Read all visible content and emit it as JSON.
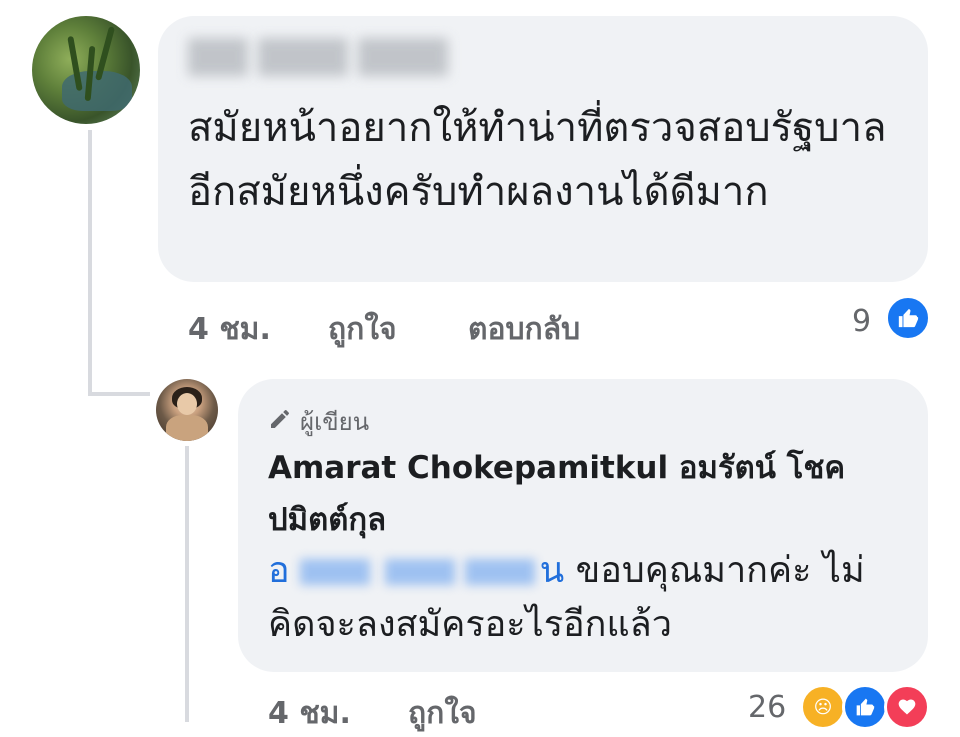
{
  "comment": {
    "author_blurred": true,
    "text": "สมัยหน้าอยากให้ทำน่าที่ตรวจสอบรัฐบาลอีกสมัยหนึ่งครับทำผลงานได้ดีมาก",
    "time": "4 ชม.",
    "like_label": "ถูกใจ",
    "reply_label": "ตอบกลับ",
    "reaction_count": "9",
    "reaction_icon": "like-icon",
    "reaction_color": "#1877f2"
  },
  "reply": {
    "badge_icon": "pencil-icon",
    "badge_label": "ผู้เขียน",
    "author": "Amarat Chokepamitkul อมรัตน์ โชคปมิตต์กุล",
    "mention_start": "อ",
    "mention_end": "น",
    "text": " ขอบคุณมากค่ะ ไม่คิดจะลงสมัครอะไรอีกแล้ว",
    "time": "4 ชม.",
    "like_label": "ถูกใจ",
    "reaction_count": "26",
    "reactions": [
      "sad-icon",
      "like-icon",
      "love-icon"
    ],
    "colors": {
      "sad": "#f7b125",
      "like": "#1877f2",
      "love": "#f33e58",
      "mention": "#216fdb"
    }
  }
}
